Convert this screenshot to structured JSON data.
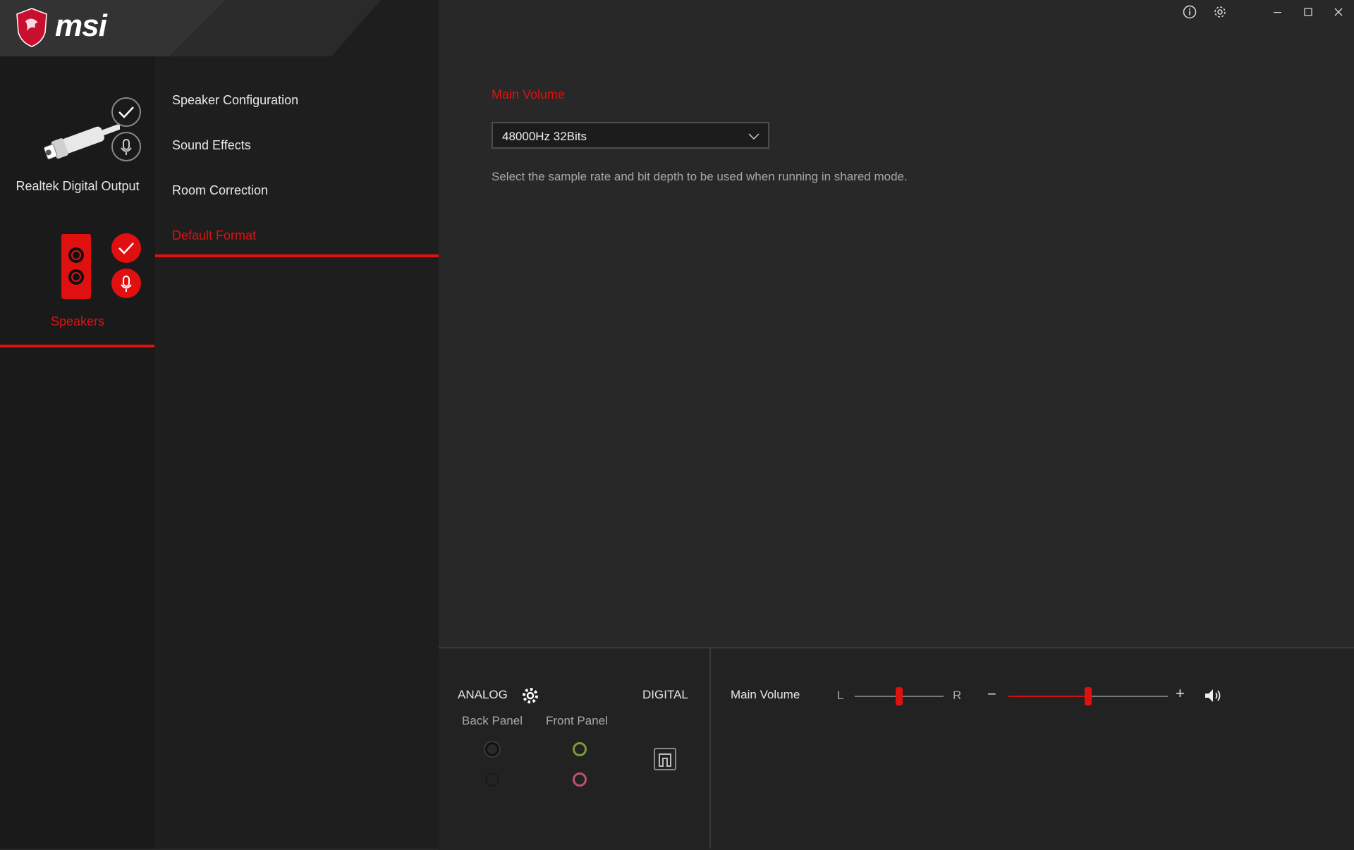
{
  "app": {
    "brand": "msi"
  },
  "window_controls": {
    "info_icon": "info-circle-icon",
    "settings_icon": "gear-icon",
    "minimize_icon": "minimize-icon",
    "maximize_icon": "maximize-icon",
    "close_icon": "close-icon"
  },
  "devices": [
    {
      "label": "Realtek Digital Output",
      "icon": "digital-cable-icon",
      "active": false
    },
    {
      "label": "Speakers",
      "icon": "speaker-icon",
      "active": true
    }
  ],
  "nav": {
    "items": [
      {
        "label": "Speaker Configuration",
        "active": false
      },
      {
        "label": "Sound Effects",
        "active": false
      },
      {
        "label": "Room Correction",
        "active": false
      },
      {
        "label": "Default Format",
        "active": true
      }
    ]
  },
  "main": {
    "section_title": "Main Volume",
    "format_select": {
      "value": "48000Hz 32Bits"
    },
    "description": "Select the sample rate and bit depth to be used when running in shared mode."
  },
  "bottom": {
    "analog_label": "ANALOG",
    "digital_label": "DIGITAL",
    "back_panel_label": "Back Panel",
    "front_panel_label": "Front Panel",
    "volume_label": "Main Volume",
    "balance_left": "L",
    "balance_right": "R",
    "minus": "−",
    "plus": "+",
    "balance_value": 0.5,
    "volume_value": 0.5
  },
  "colors": {
    "accent": "#e01010",
    "background": "#282828",
    "sidebar": "#1a1a1a",
    "nav": "#1e1e1e",
    "jack_green": "#7a9a3a",
    "jack_pink": "#c0506a"
  }
}
